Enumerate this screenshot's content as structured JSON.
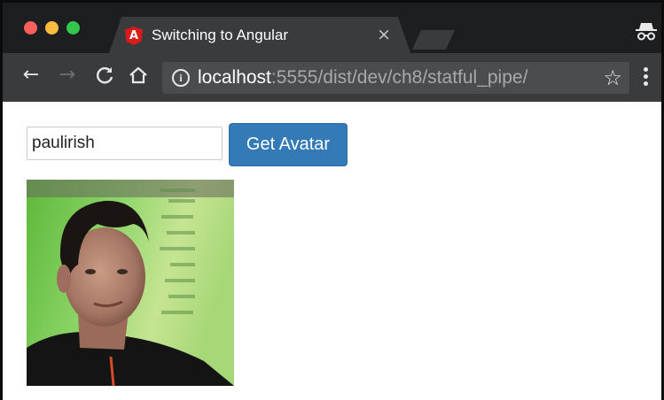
{
  "browser": {
    "tab": {
      "title": "Switching to Angular",
      "favicon_letter": "A",
      "close_glyph": "×"
    },
    "toolbar": {
      "back_glyph": "←",
      "forward_glyph": "→",
      "reload_glyph": "C",
      "home_glyph": "⌂",
      "info_glyph": "i",
      "url_host": "localhost",
      "url_rest": ":5555/dist/dev/ch8/statful_pipe/",
      "star_glyph": "☆"
    },
    "icons": [
      "close-icon",
      "back-arrow-icon",
      "forward-arrow-icon",
      "reload-icon",
      "home-icon",
      "info-icon",
      "star-icon",
      "menu-icon",
      "incognito-icon",
      "angular-logo-icon"
    ]
  },
  "page": {
    "username_value": "paulirish",
    "get_avatar_label": "Get Avatar"
  },
  "colors": {
    "titlebar": "#1d1e20",
    "toolbar": "#3a3b3d",
    "primary_button": "#337ab7",
    "angular_red": "#dd1b16"
  }
}
